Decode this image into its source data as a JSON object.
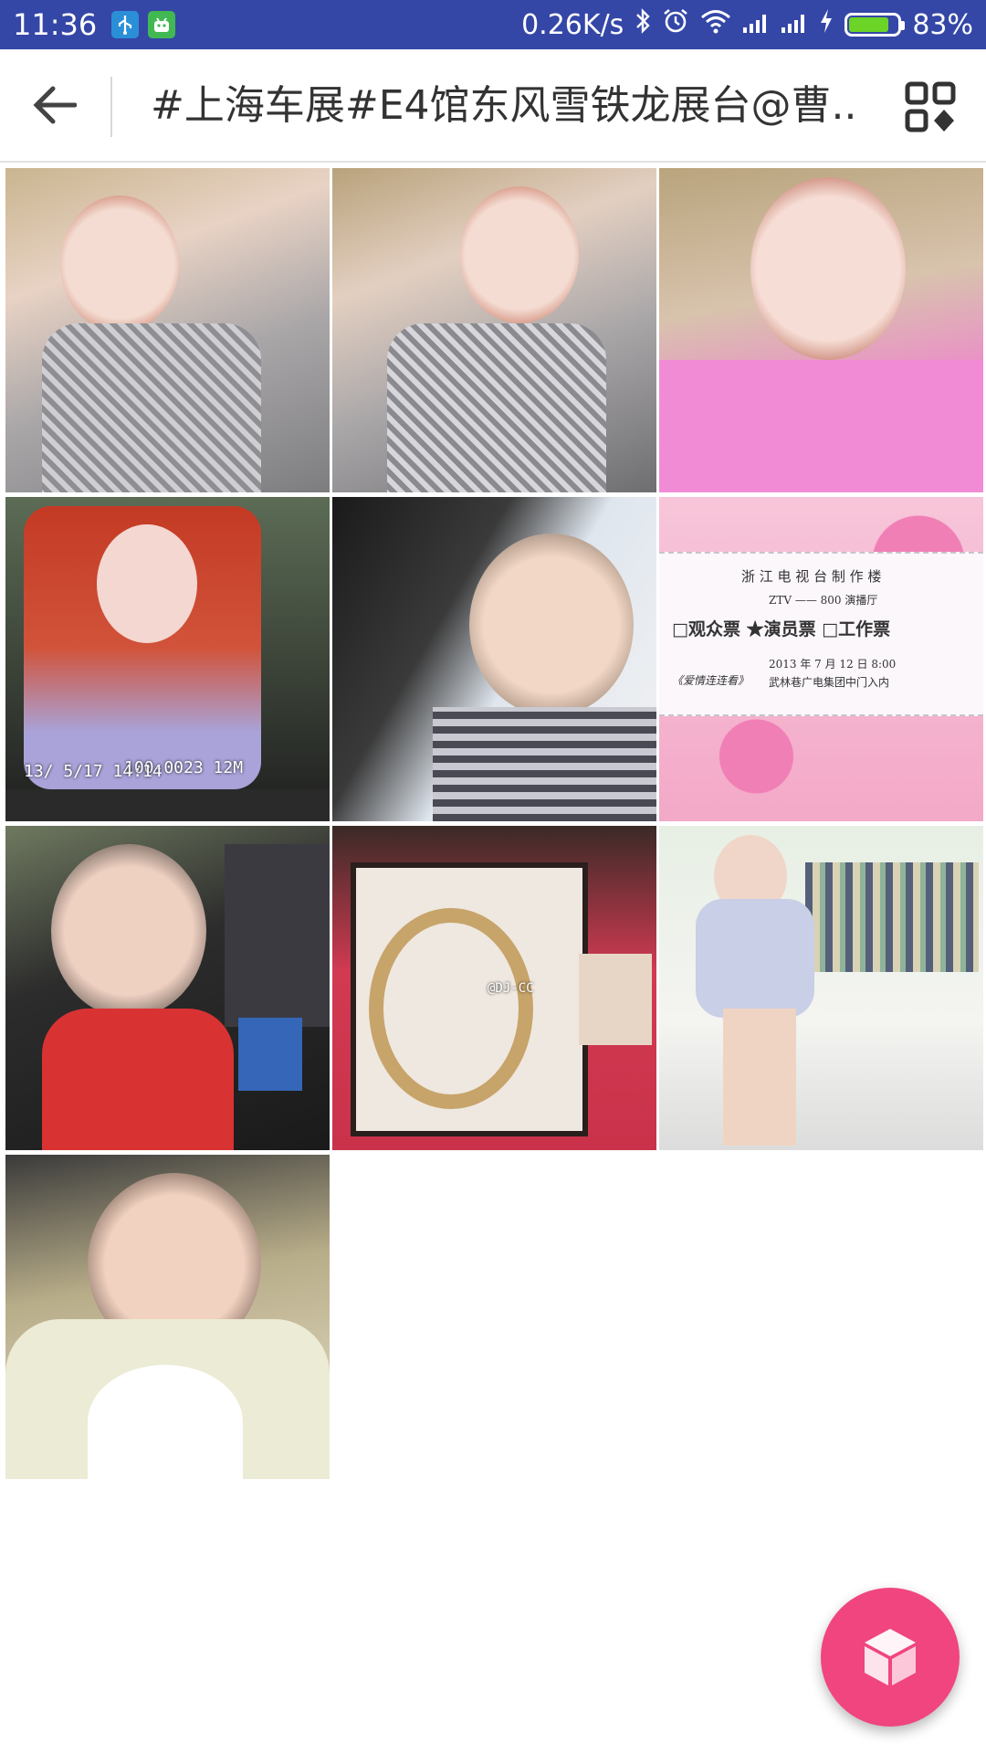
{
  "status_bar": {
    "time": "11:36",
    "network_speed": "0.26K/s",
    "battery_percent": "83%",
    "battery_level": 0.83,
    "icons": [
      "usb-icon",
      "android-icon",
      "bluetooth-icon",
      "alarm-icon",
      "wifi-icon",
      "signal-icon",
      "signal-icon",
      "charging-icon",
      "battery-icon"
    ]
  },
  "toolbar": {
    "title": "#上海车展#E4馆东风雪铁龙展台@曹..",
    "back_icon": "arrow-left-icon",
    "grid_icon": "grid-view-icon"
  },
  "photos": [
    {
      "id": "photo-1",
      "caption": ""
    },
    {
      "id": "photo-2",
      "caption": ""
    },
    {
      "id": "photo-3",
      "caption": ""
    },
    {
      "id": "photo-4",
      "caption": "100-0023 12M",
      "caption2": "13/ 5/17 14:14"
    },
    {
      "id": "photo-5",
      "caption": ""
    },
    {
      "id": "photo-6",
      "ticket_title": "浙 江 电 视 台 制 作 楼",
      "ticket_hall": "ZTV —— 800 演播厅",
      "ticket_types": "□观众票 ★演员票 □工作票",
      "ticket_date": "2013 年 7 月 12 日 8:00",
      "ticket_show": "《爱情连连看》",
      "ticket_gate": "武林巷广电集团中门入内"
    },
    {
      "id": "photo-7",
      "caption": ""
    },
    {
      "id": "photo-8",
      "caption": "@DJ-CC"
    },
    {
      "id": "photo-9",
      "caption": ""
    },
    {
      "id": "photo-10",
      "caption": ""
    }
  ],
  "fab": {
    "icon": "cube-icon"
  },
  "colors": {
    "status_bar": "#3447a7",
    "accent": "#f0457f",
    "title_text": "#333333"
  }
}
